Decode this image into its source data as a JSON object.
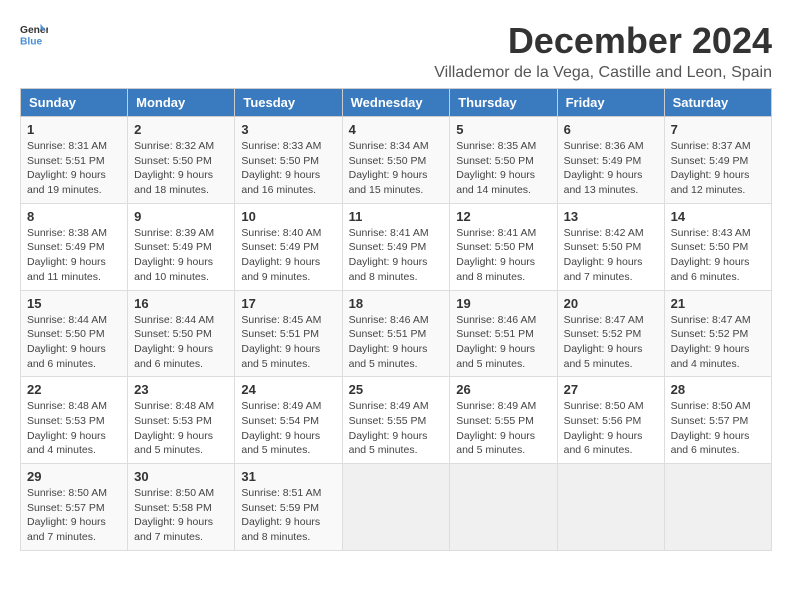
{
  "header": {
    "logo_general": "General",
    "logo_blue": "Blue",
    "title": "December 2024",
    "subtitle": "Villademor de la Vega, Castille and Leon, Spain"
  },
  "weekdays": [
    "Sunday",
    "Monday",
    "Tuesday",
    "Wednesday",
    "Thursday",
    "Friday",
    "Saturday"
  ],
  "weeks": [
    [
      {
        "day": "1",
        "sunrise": "8:31 AM",
        "sunset": "5:51 PM",
        "daylight": "9 hours and 19 minutes."
      },
      {
        "day": "2",
        "sunrise": "8:32 AM",
        "sunset": "5:50 PM",
        "daylight": "9 hours and 18 minutes."
      },
      {
        "day": "3",
        "sunrise": "8:33 AM",
        "sunset": "5:50 PM",
        "daylight": "9 hours and 16 minutes."
      },
      {
        "day": "4",
        "sunrise": "8:34 AM",
        "sunset": "5:50 PM",
        "daylight": "9 hours and 15 minutes."
      },
      {
        "day": "5",
        "sunrise": "8:35 AM",
        "sunset": "5:50 PM",
        "daylight": "9 hours and 14 minutes."
      },
      {
        "day": "6",
        "sunrise": "8:36 AM",
        "sunset": "5:49 PM",
        "daylight": "9 hours and 13 minutes."
      },
      {
        "day": "7",
        "sunrise": "8:37 AM",
        "sunset": "5:49 PM",
        "daylight": "9 hours and 12 minutes."
      }
    ],
    [
      {
        "day": "8",
        "sunrise": "8:38 AM",
        "sunset": "5:49 PM",
        "daylight": "9 hours and 11 minutes."
      },
      {
        "day": "9",
        "sunrise": "8:39 AM",
        "sunset": "5:49 PM",
        "daylight": "9 hours and 10 minutes."
      },
      {
        "day": "10",
        "sunrise": "8:40 AM",
        "sunset": "5:49 PM",
        "daylight": "9 hours and 9 minutes."
      },
      {
        "day": "11",
        "sunrise": "8:41 AM",
        "sunset": "5:49 PM",
        "daylight": "9 hours and 8 minutes."
      },
      {
        "day": "12",
        "sunrise": "8:41 AM",
        "sunset": "5:50 PM",
        "daylight": "9 hours and 8 minutes."
      },
      {
        "day": "13",
        "sunrise": "8:42 AM",
        "sunset": "5:50 PM",
        "daylight": "9 hours and 7 minutes."
      },
      {
        "day": "14",
        "sunrise": "8:43 AM",
        "sunset": "5:50 PM",
        "daylight": "9 hours and 6 minutes."
      }
    ],
    [
      {
        "day": "15",
        "sunrise": "8:44 AM",
        "sunset": "5:50 PM",
        "daylight": "9 hours and 6 minutes."
      },
      {
        "day": "16",
        "sunrise": "8:44 AM",
        "sunset": "5:50 PM",
        "daylight": "9 hours and 6 minutes."
      },
      {
        "day": "17",
        "sunrise": "8:45 AM",
        "sunset": "5:51 PM",
        "daylight": "9 hours and 5 minutes."
      },
      {
        "day": "18",
        "sunrise": "8:46 AM",
        "sunset": "5:51 PM",
        "daylight": "9 hours and 5 minutes."
      },
      {
        "day": "19",
        "sunrise": "8:46 AM",
        "sunset": "5:51 PM",
        "daylight": "9 hours and 5 minutes."
      },
      {
        "day": "20",
        "sunrise": "8:47 AM",
        "sunset": "5:52 PM",
        "daylight": "9 hours and 5 minutes."
      },
      {
        "day": "21",
        "sunrise": "8:47 AM",
        "sunset": "5:52 PM",
        "daylight": "9 hours and 4 minutes."
      }
    ],
    [
      {
        "day": "22",
        "sunrise": "8:48 AM",
        "sunset": "5:53 PM",
        "daylight": "9 hours and 4 minutes."
      },
      {
        "day": "23",
        "sunrise": "8:48 AM",
        "sunset": "5:53 PM",
        "daylight": "9 hours and 5 minutes."
      },
      {
        "day": "24",
        "sunrise": "8:49 AM",
        "sunset": "5:54 PM",
        "daylight": "9 hours and 5 minutes."
      },
      {
        "day": "25",
        "sunrise": "8:49 AM",
        "sunset": "5:55 PM",
        "daylight": "9 hours and 5 minutes."
      },
      {
        "day": "26",
        "sunrise": "8:49 AM",
        "sunset": "5:55 PM",
        "daylight": "9 hours and 5 minutes."
      },
      {
        "day": "27",
        "sunrise": "8:50 AM",
        "sunset": "5:56 PM",
        "daylight": "9 hours and 6 minutes."
      },
      {
        "day": "28",
        "sunrise": "8:50 AM",
        "sunset": "5:57 PM",
        "daylight": "9 hours and 6 minutes."
      }
    ],
    [
      {
        "day": "29",
        "sunrise": "8:50 AM",
        "sunset": "5:57 PM",
        "daylight": "9 hours and 7 minutes."
      },
      {
        "day": "30",
        "sunrise": "8:50 AM",
        "sunset": "5:58 PM",
        "daylight": "9 hours and 7 minutes."
      },
      {
        "day": "31",
        "sunrise": "8:51 AM",
        "sunset": "5:59 PM",
        "daylight": "9 hours and 8 minutes."
      },
      null,
      null,
      null,
      null
    ]
  ]
}
